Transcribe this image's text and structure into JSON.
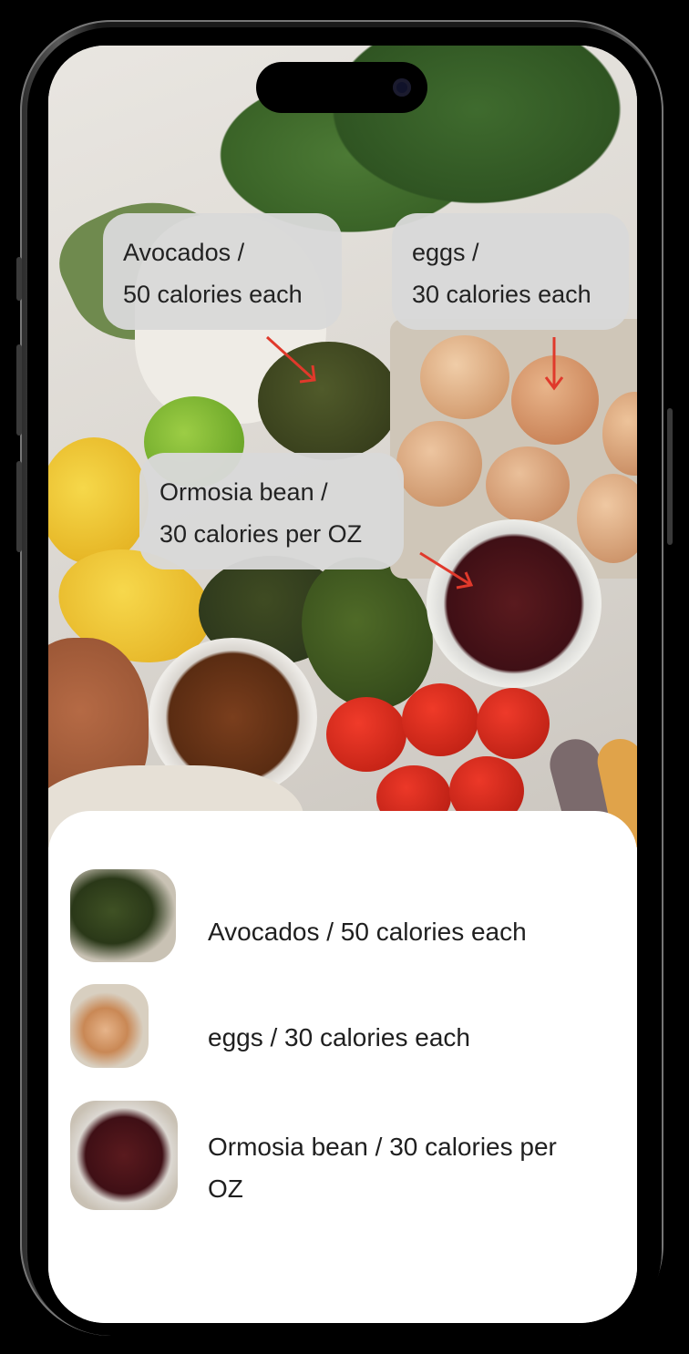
{
  "callouts": [
    {
      "line1": "Avocados /",
      "line2": "50 calories each"
    },
    {
      "line1": "eggs /",
      "line2": "30 calories each"
    },
    {
      "line1": "Ormosia bean /",
      "line2": "30 calories per OZ"
    }
  ],
  "list": [
    {
      "text": "Avocados / 50 calories each"
    },
    {
      "text": "eggs / 30 calories each"
    },
    {
      "text": "Ormosia bean / 30 calories per OZ"
    }
  ],
  "colors": {
    "arrow": "#e0392b",
    "callout_bg": "#d8d8d8",
    "sheet_bg": "#ffffff"
  },
  "icons": [
    "camera-icon"
  ]
}
